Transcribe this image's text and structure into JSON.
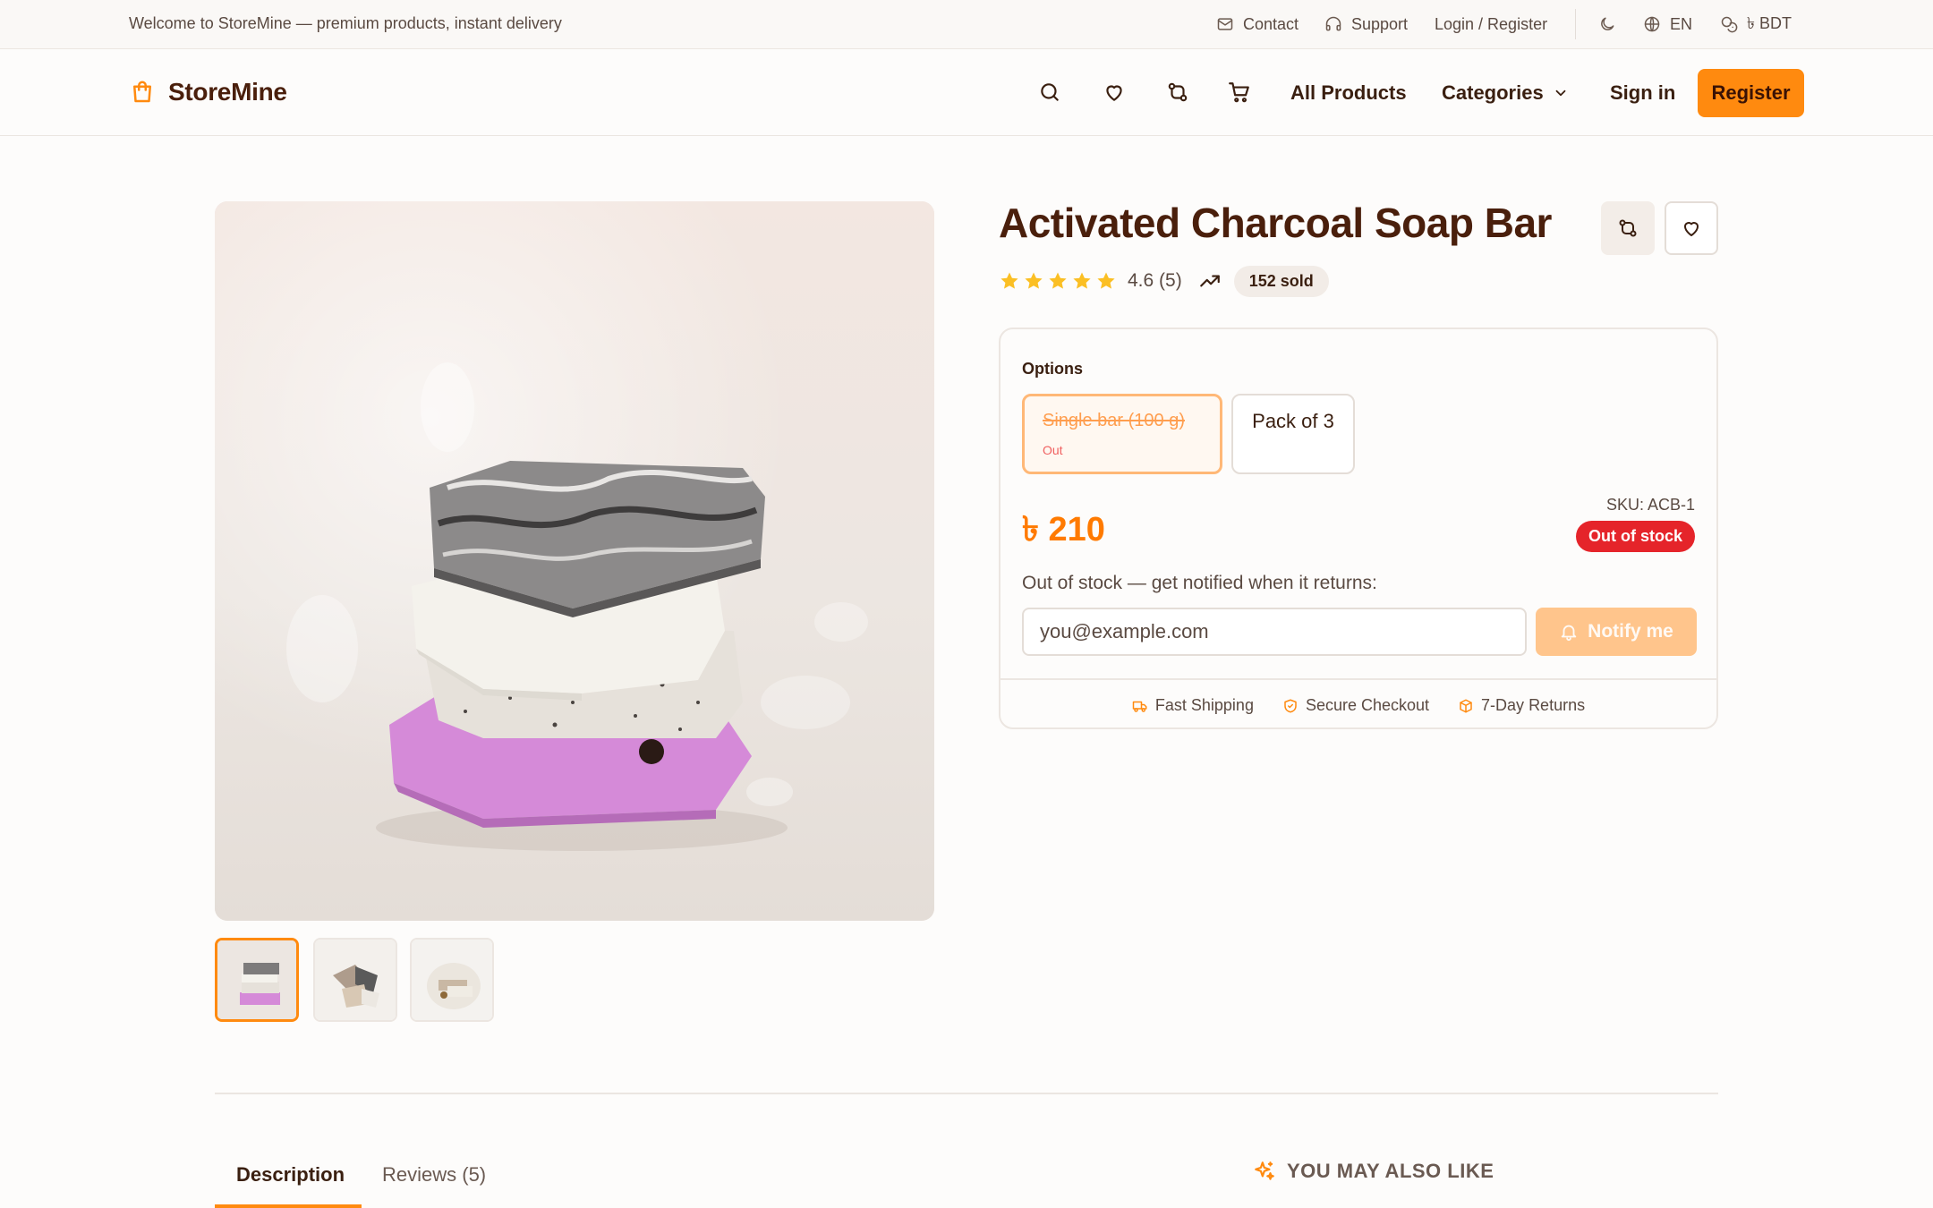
{
  "topbar": {
    "welcome": "Welcome to StoreMine — premium products, instant delivery",
    "contact": "Contact",
    "support": "Support",
    "login": "Login / Register",
    "language": "EN",
    "currency": "৳ BDT"
  },
  "header": {
    "brand": "StoreMine",
    "all_products": "All Products",
    "categories": "Categories",
    "sign_in": "Sign in",
    "register": "Register"
  },
  "product": {
    "title": "Activated Charcoal Soap Bar",
    "rating": "4.6 (5)",
    "sold": "152 sold",
    "options_label": "Options",
    "options": [
      {
        "name": "Single bar (100 g)",
        "status": "Out"
      },
      {
        "name": "Pack of 3"
      }
    ],
    "price": "৳ 210",
    "sku": "SKU: ACB-1",
    "stock_badge": "Out of stock",
    "notify_text": "Out of stock — get notified when it returns:",
    "email_placeholder": "you@example.com",
    "notify_button": "Notify me",
    "features": [
      "Fast Shipping",
      "Secure Checkout",
      "7-Day Returns"
    ]
  },
  "tabs": {
    "description": "Description",
    "reviews": "Reviews (5)"
  },
  "related": {
    "heading": "YOU MAY ALSO LIKE"
  },
  "colors": {
    "accent": "#ff8a0f",
    "brand_text": "#4a1f0c",
    "danger": "#e5242a",
    "star": "#fbbf24"
  },
  "icons": [
    "mail-icon",
    "headphones-icon",
    "moon-icon",
    "globe-icon",
    "currency-icon",
    "shopping-bag-icon",
    "search-icon",
    "heart-icon",
    "compare-icon",
    "cart-icon",
    "chevron-down-icon",
    "star-icon",
    "trending-up-icon",
    "bell-icon",
    "truck-icon",
    "shield-icon",
    "box-icon",
    "sparkles-icon"
  ]
}
